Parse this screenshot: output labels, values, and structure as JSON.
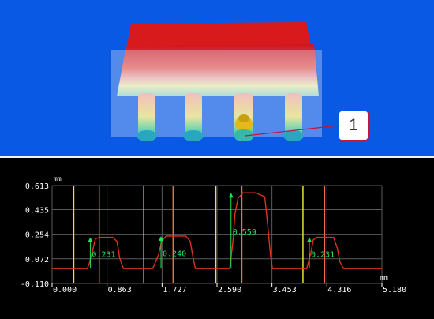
{
  "colors": {
    "top_background": "#0a59e4",
    "plot_background": "#000000",
    "grid": "#5a5a5a",
    "profile": "#e03020",
    "marker_yellow": "#e6e62a",
    "marker_red": "#f06a50",
    "measurement": "#26e055",
    "axis_text": "#ffffff",
    "callout_border": "#c3143c"
  },
  "top_view": {
    "icon": "3d-height-map-of-ic-chip",
    "callout": {
      "label": "1"
    }
  },
  "chart_data": {
    "type": "line",
    "title": "",
    "xlabel": "mm",
    "ylabel": "mm",
    "xlim": [
      0,
      5.18
    ],
    "ylim": [
      -0.11,
      0.613
    ],
    "grid": true,
    "x_ticks": [
      "0.000",
      "0.863",
      "1.727",
      "2.590",
      "3.453",
      "4.316",
      "5.180"
    ],
    "y_ticks": [
      "0.613",
      "0.435",
      "0.254",
      "0.072",
      "-0.110"
    ],
    "series": [
      {
        "x": [
          0,
          0.55,
          0.58,
          0.63,
          0.68,
          0.75,
          0.95,
          1.02,
          1.06,
          1.12,
          1.58,
          1.67,
          1.72,
          1.79,
          1.85,
          2.1,
          2.17,
          2.21,
          2.25,
          2.79,
          2.84,
          2.87,
          2.92,
          3.0,
          3.2,
          3.34,
          3.38,
          3.43,
          3.46,
          4.0,
          4.07,
          4.1,
          4.15,
          4.22,
          4.42,
          4.48,
          4.52,
          4.58,
          5.18
        ],
        "y": [
          0.0,
          0.0,
          0.03,
          0.12,
          0.22,
          0.231,
          0.231,
          0.2,
          0.08,
          0.0,
          0.0,
          0.1,
          0.2,
          0.24,
          0.24,
          0.24,
          0.2,
          0.09,
          0.0,
          0.0,
          0.2,
          0.4,
          0.52,
          0.559,
          0.559,
          0.53,
          0.35,
          0.1,
          0.0,
          0.0,
          0.13,
          0.21,
          0.231,
          0.231,
          0.231,
          0.15,
          0.05,
          0.0,
          0.0
        ]
      }
    ],
    "markers": {
      "yellow_x": [
        0.34,
        1.44,
        2.57,
        3.94
      ],
      "red_x": [
        0.74,
        1.9,
        2.98,
        4.28
      ]
    },
    "measurements": [
      {
        "label": "0.231",
        "x": 0.6,
        "from": 0.0,
        "to": 0.231
      },
      {
        "label": "0.240",
        "x": 1.71,
        "from": 0.0,
        "to": 0.24
      },
      {
        "label": "0.559",
        "x": 2.81,
        "from": 0.0,
        "to": 0.559
      },
      {
        "label": "0.231",
        "x": 4.04,
        "from": 0.0,
        "to": 0.231
      }
    ]
  }
}
